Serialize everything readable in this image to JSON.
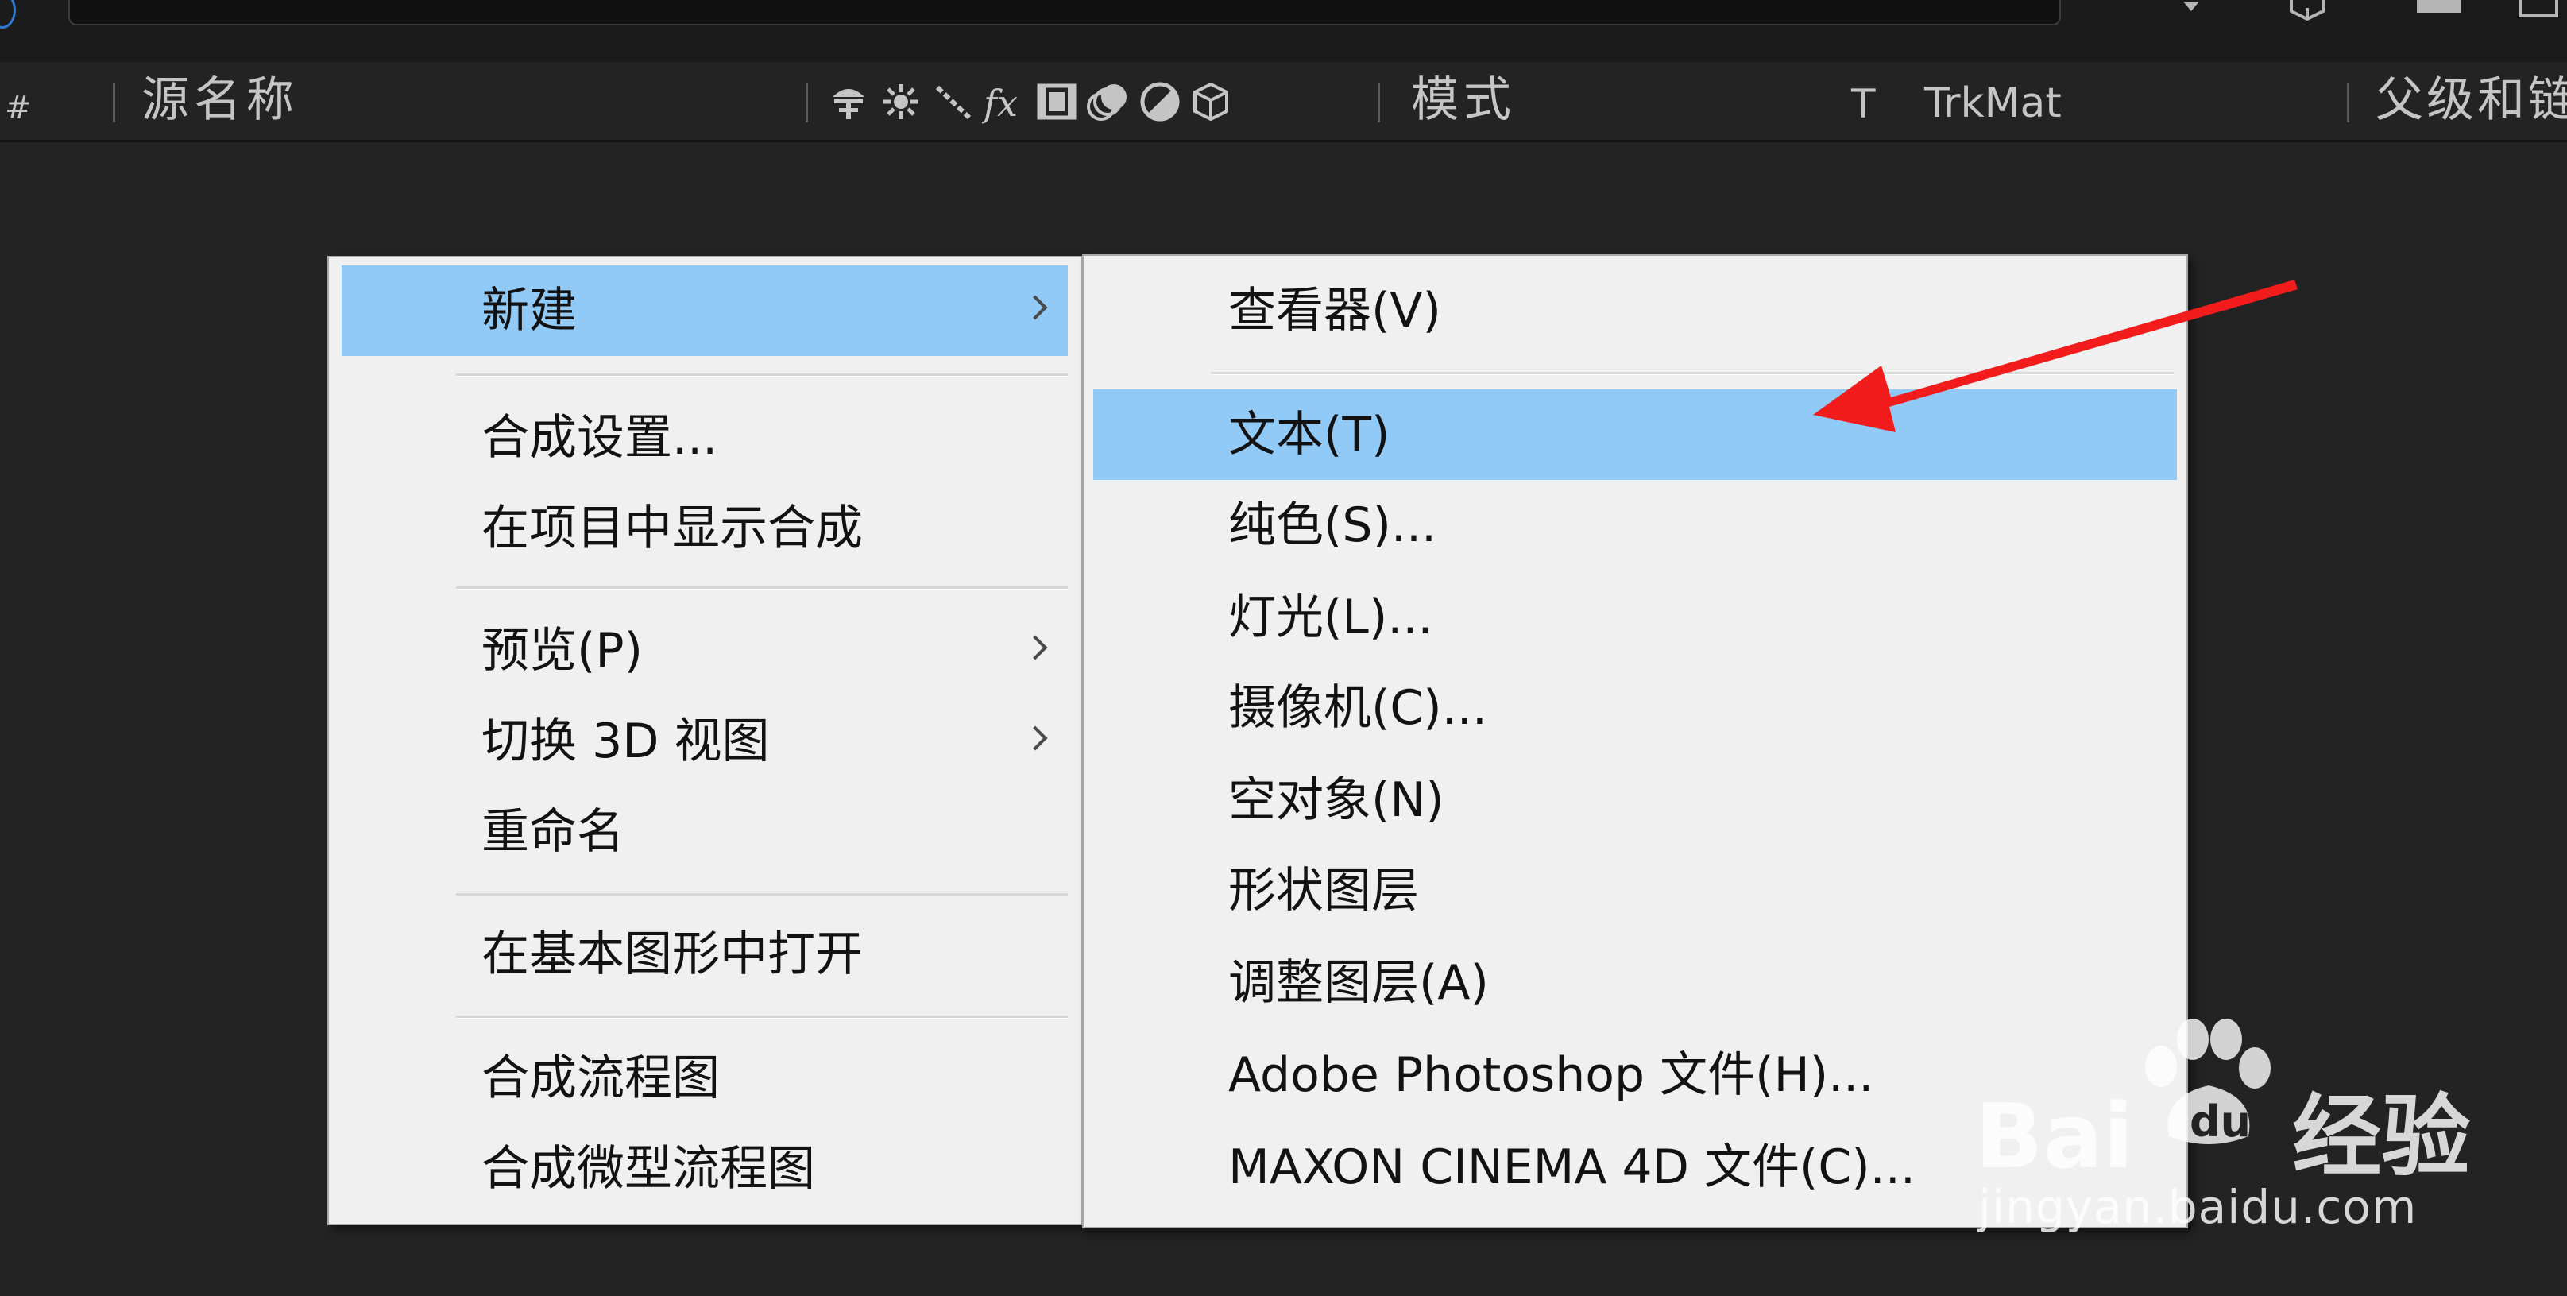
{
  "header": {
    "hash": "#",
    "source_name": "源名称",
    "mode": "模式",
    "t_col": "T",
    "trkmat": "TrkMat",
    "parent": "父级和链"
  },
  "context_menu": {
    "items": [
      {
        "label": "新建",
        "has_submenu": true,
        "highlighted": true
      },
      {
        "label": "合成设置..."
      },
      {
        "label": "在项目中显示合成"
      },
      {
        "label": "预览(P)",
        "has_submenu": true
      },
      {
        "label": "切换 3D 视图",
        "has_submenu": true
      },
      {
        "label": "重命名"
      },
      {
        "label": "在基本图形中打开"
      },
      {
        "label": "合成流程图"
      },
      {
        "label": "合成微型流程图"
      }
    ]
  },
  "submenu": {
    "items": [
      {
        "label": "查看器(V)"
      },
      {
        "label": "文本(T)",
        "highlighted": true
      },
      {
        "label": "纯色(S)..."
      },
      {
        "label": "灯光(L)..."
      },
      {
        "label": "摄像机(C)..."
      },
      {
        "label": "空对象(N)"
      },
      {
        "label": "形状图层"
      },
      {
        "label": "调整图层(A)"
      },
      {
        "label": "Adobe Photoshop 文件(H)..."
      },
      {
        "label": "MAXON CINEMA 4D 文件(C)..."
      }
    ]
  },
  "watermark": {
    "brand": "Bai",
    "brand_tail": "经验",
    "url": "jingyan.baidu.com"
  },
  "colors": {
    "highlight": "#91c9f7",
    "menu_bg": "#f0f0f0",
    "panel_bg": "#232323",
    "arrow": "#f21c1c"
  }
}
